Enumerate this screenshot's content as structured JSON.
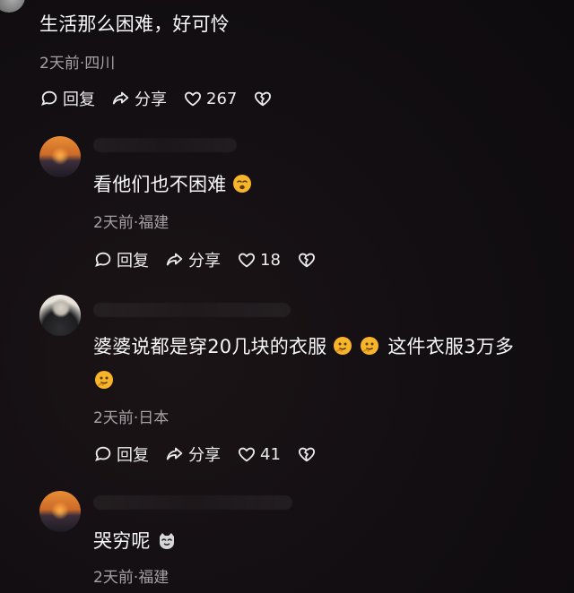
{
  "comments": [
    {
      "text": "生活那么困难，好可怜",
      "meta": "2天前·四川",
      "actions": {
        "reply": "回复",
        "share": "分享",
        "likes": "267"
      }
    },
    {
      "text": "看他们也不困难",
      "meta": "2天前·福建",
      "actions": {
        "reply": "回复",
        "share": "分享",
        "likes": "18"
      }
    },
    {
      "text_line1": "婆婆说都是穿20几块的衣服",
      "text_line1_tail": "这件衣服3万多",
      "meta": "2天前·日本",
      "actions": {
        "reply": "回复",
        "share": "分享",
        "likes": "41"
      }
    },
    {
      "text": "哭穷呢",
      "meta": "2天前·福建"
    }
  ],
  "colors": {
    "background": "#120e12",
    "text": "#f3f3f3",
    "meta": "#a6a1a6"
  },
  "icons": {
    "reply": "reply-bubble-icon",
    "share": "share-arrow-icon",
    "like": "heart-icon",
    "dislike": "broken-heart-icon",
    "emoji_sleepy": "sleepy-face-emoji",
    "emoji_thinking": "thinking-face-emoji",
    "emoji_cat": "cat-face-emoji"
  }
}
